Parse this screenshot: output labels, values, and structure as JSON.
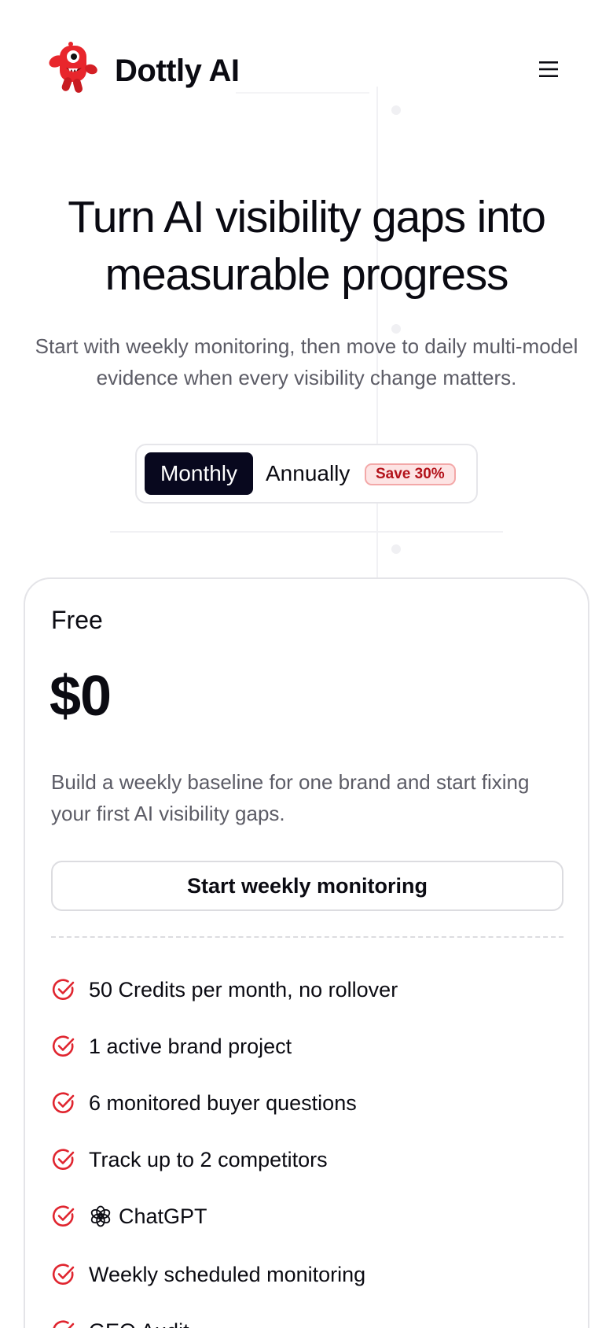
{
  "header": {
    "brand_name": "Dottly AI",
    "logo_icon": "red-monster-mascot",
    "menu_icon": "hamburger-menu-icon"
  },
  "hero": {
    "title": "Turn AI visibility gaps into measurable progress",
    "subtitle": "Start with weekly monitoring, then move to daily multi-model evidence when every visibility change matters."
  },
  "billing_toggle": {
    "monthly_label": "Monthly",
    "annually_label": "Annually",
    "save_badge": "Save 30%",
    "selected": "Monthly"
  },
  "plan": {
    "name": "Free",
    "price": "$0",
    "description": "Build a weekly baseline for one brand and start fixing your first AI visibility gaps.",
    "cta_label": "Start weekly monitoring",
    "features": [
      "50 Credits per month, no rollover",
      "1 active brand project",
      "6 monitored buyer questions",
      "Track up to 2 competitors",
      "ChatGPT",
      "Weekly scheduled monitoring",
      "GEO Audit"
    ]
  },
  "colors": {
    "accent_dark": "#08081e",
    "check_red": "#e0252f",
    "badge_bg": "#fde4e4",
    "badge_text": "#b3131b",
    "muted_text": "#5c5c66"
  }
}
